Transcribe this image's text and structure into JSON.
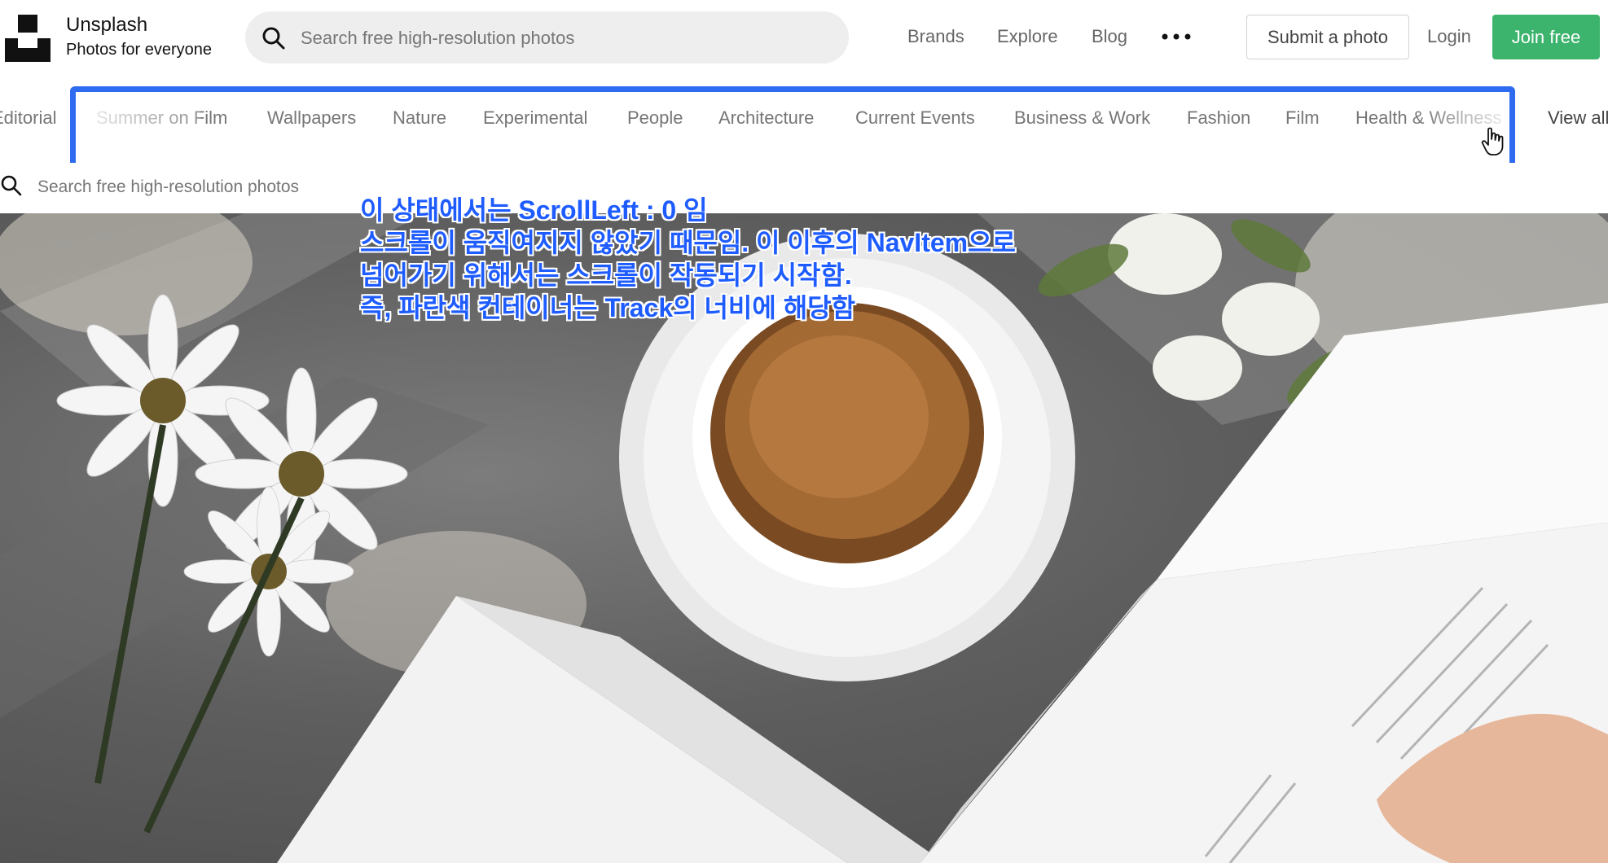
{
  "header": {
    "brand_name": "Unsplash",
    "brand_tagline": "Photos for everyone",
    "search_placeholder": "Search free high-resolution photos",
    "nav_links": [
      "Brands",
      "Explore",
      "Blog"
    ],
    "submit_label": "Submit a photo",
    "login_label": "Login",
    "join_label": "Join free",
    "join_color": "#3cb46e"
  },
  "topics": [
    "Editorial",
    "Summer on Film",
    "Wallpapers",
    "Nature",
    "Experimental",
    "People",
    "Architecture",
    "Current Events",
    "Business & Work",
    "Fashion",
    "Film",
    "Health & Wellness",
    "View all"
  ],
  "secondary_search": {
    "placeholder": "Search free high-resolution photos"
  },
  "annotation": {
    "color": "#1e5cff",
    "box_color": "#2e6bf0",
    "lines": [
      "이 상태에서는 ScrollLeft : 0 임",
      "스크롤이 움직여지지 않았기 때문임. 이 이후의 NavItem으로",
      "넘어가기 위해서는 스크롤이 작동되기 시작함.",
      "즉, 파란색 컨테이너는 Track의 너비에 해당함"
    ]
  },
  "icons": {
    "search": "search-icon",
    "more": "more-horizontal-icon",
    "cursor": "hand-pointer-icon",
    "logo": "unsplash-logo-icon"
  }
}
